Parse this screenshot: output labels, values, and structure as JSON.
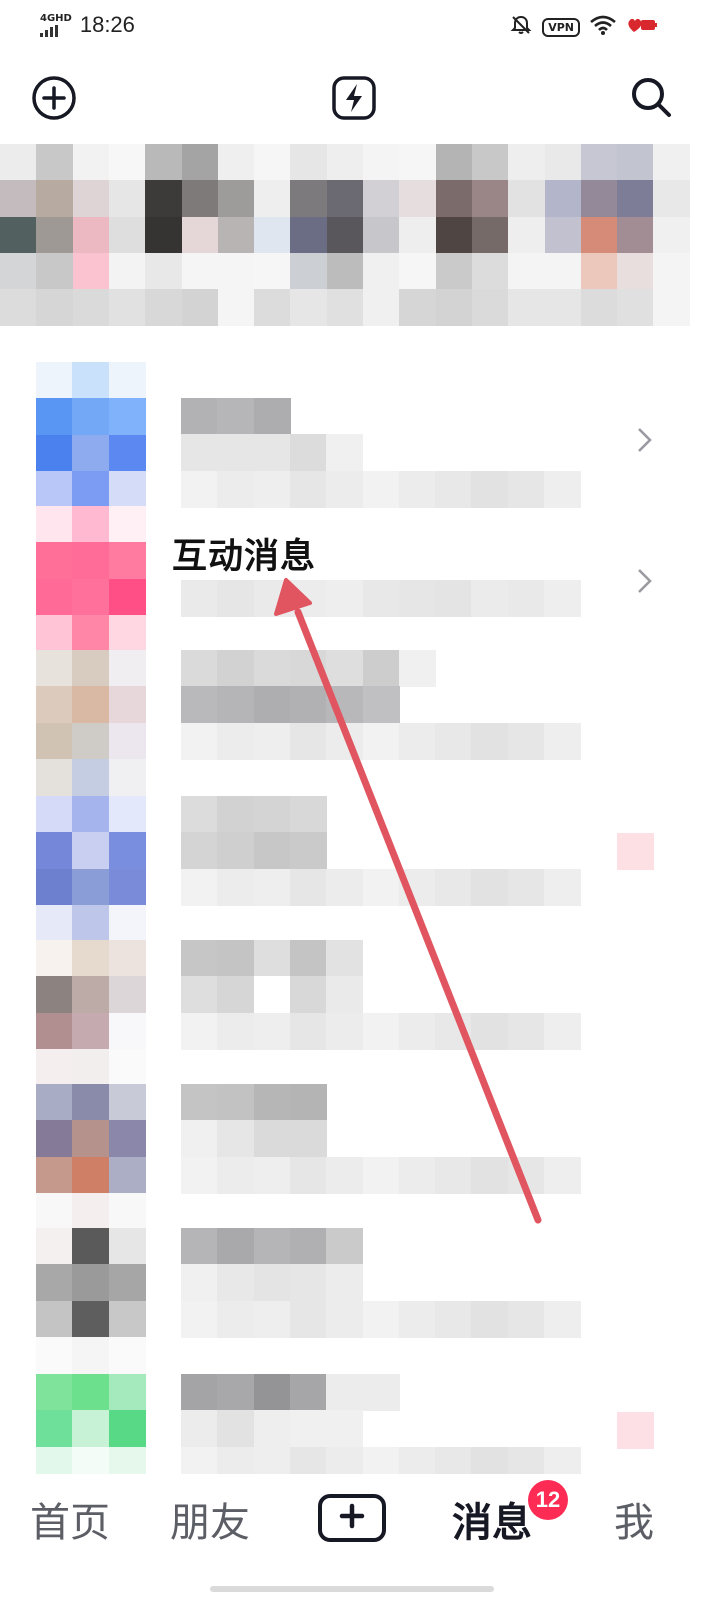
{
  "status_bar": {
    "network": "4GHD",
    "time": "18:26",
    "vpn_label": "VPN",
    "icons": [
      "mute-bell-icon",
      "vpn-icon",
      "wifi-icon",
      "battery-icon"
    ]
  },
  "top_bar": {
    "icons": [
      "add-circle-icon",
      "flash-icon",
      "search-icon"
    ]
  },
  "messages": {
    "interaction_label": "互动消息"
  },
  "bottom_nav": {
    "items": [
      {
        "label": "首页",
        "active": false
      },
      {
        "label": "朋友",
        "active": false
      },
      {
        "label": "",
        "icon": "plus-icon",
        "active": false
      },
      {
        "label": "消息",
        "active": true,
        "badge": "12"
      },
      {
        "label": "我",
        "active": false
      }
    ]
  },
  "annotation": {
    "color": "#e05560",
    "icon": "annotation-arrow"
  },
  "colors": {
    "accent": "#fe2c55",
    "text_primary": "#161823",
    "text_secondary": "#5c5e66"
  }
}
